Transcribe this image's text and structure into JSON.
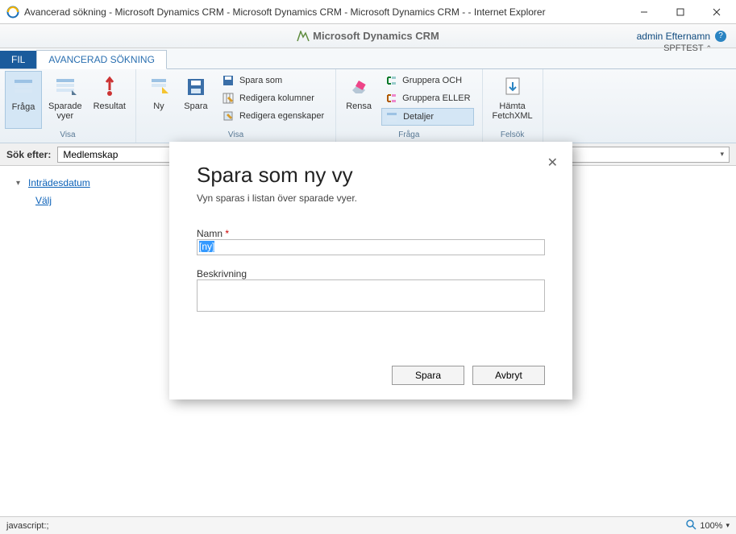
{
  "window": {
    "title": "Avancerad sökning - Microsoft Dynamics CRM - Microsoft Dynamics CRM - Microsoft Dynamics CRM -  - Internet Explorer"
  },
  "crm": {
    "product": "Microsoft Dynamics CRM",
    "user": "admin Efternamn",
    "org": "SPFTEST"
  },
  "tabs": {
    "file": "FIL",
    "advanced_find": "AVANCERAD SÖKNING"
  },
  "ribbon": {
    "groups": {
      "show": "Visa",
      "view": "Visa",
      "query": "Fråga",
      "debug": "Felsök"
    },
    "buttons": {
      "query": "Fråga",
      "saved_views": "Sparade\nvyer",
      "results": "Resultat",
      "new": "Ny",
      "save": "Spara",
      "save_as": "Spara som",
      "edit_columns": "Redigera kolumner",
      "edit_properties": "Redigera egenskaper",
      "clear": "Rensa",
      "group_and": "Gruppera OCH",
      "group_or": "Gruppera ELLER",
      "details": "Detaljer",
      "download_fetchxml": "Hämta\nFetchXML"
    }
  },
  "searchbar": {
    "label": "Sök efter:",
    "value": "Medlemskap"
  },
  "query_area": {
    "field": "Inträdesdatum",
    "select": "Välj"
  },
  "modal": {
    "title": "Spara som ny vy",
    "subtitle": "Vyn sparas i listan över sparade vyer.",
    "name_label": "Namn",
    "name_value": "[ny]",
    "desc_label": "Beskrivning",
    "desc_value": "",
    "save": "Spara",
    "cancel": "Avbryt"
  },
  "statusbar": {
    "left": "javascript:;",
    "zoom": "100%"
  }
}
